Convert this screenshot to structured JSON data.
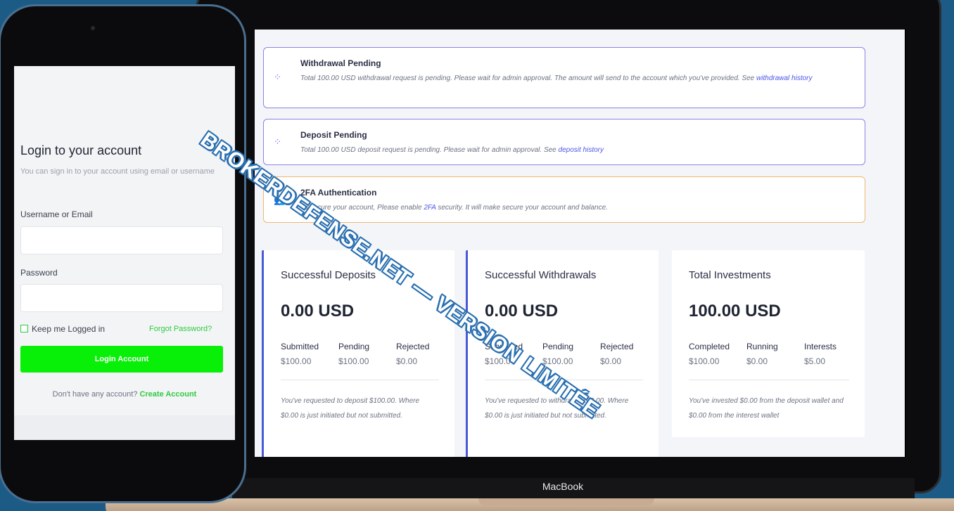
{
  "alerts": [
    {
      "icon": "spinner-icon",
      "title": "Withdrawal Pending",
      "text": "Total 100.00 USD withdrawal request is pending. Please wait for admin approval. The amount will send to the account which you've provided. See",
      "link": "withdrawal history"
    },
    {
      "icon": "spinner-icon",
      "title": "Deposit Pending",
      "text": "Total 100.00 USD deposit request is pending. Please wait for admin approval. See",
      "link": "deposit history"
    },
    {
      "icon": "users-icon",
      "title": "2FA Authentication",
      "text_before": "To secure your account, Please enable",
      "link": "2FA",
      "text_after": "security. It will make secure your account and balance."
    }
  ],
  "cards": [
    {
      "title": "Successful Deposits",
      "amount": "0.00 USD",
      "stats": [
        {
          "label": "Submitted",
          "value": "$100.00"
        },
        {
          "label": "Pending",
          "value": "$100.00"
        },
        {
          "label": "Rejected",
          "value": "$0.00"
        }
      ],
      "note": "You've requested to deposit $100.00. Where $0.00 is just initiated but not submitted."
    },
    {
      "title": "Successful Withdrawals",
      "amount": "0.00 USD",
      "stats": [
        {
          "label": "Submitted",
          "value": "$100.00"
        },
        {
          "label": "Pending",
          "value": "$100.00"
        },
        {
          "label": "Rejected",
          "value": "$0.00"
        }
      ],
      "note": "You've requested to withdraw $100.00. Where $0.00 is just initiated but not submitted."
    },
    {
      "title": "Total Investments",
      "amount": "100.00 USD",
      "stats": [
        {
          "label": "Completed",
          "value": "$100.00"
        },
        {
          "label": "Running",
          "value": "$0.00"
        },
        {
          "label": "Interests",
          "value": "$5.00"
        }
      ],
      "note": "You've invested $0.00 from the deposit wallet and $0.00 from the interest wallet"
    }
  ],
  "laptop": {
    "label": "MacBook"
  },
  "phone": {
    "title": "Login to your account",
    "subtitle": "You can sign in to your account using email or username",
    "username_label": "Username or Email",
    "password_label": "Password",
    "keep_logged_in": "Keep me Logged in",
    "forgot_password": "Forgot Password?",
    "login_button": "Login Account",
    "no_account": "Don't have any account?",
    "create_account": "Create Account"
  },
  "watermark": "BROKERDEFENSE.NET — VERSION LIMITÉE",
  "colors": {
    "accent": "#4a59d6",
    "login_green": "#08ef08",
    "link_green": "#2ecc40",
    "background": "#1b5b86"
  }
}
